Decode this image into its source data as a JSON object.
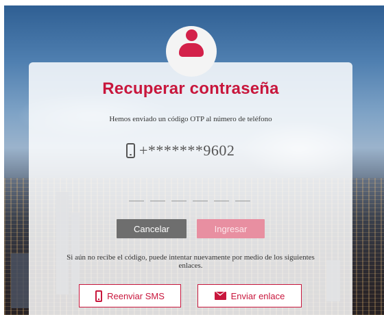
{
  "colors": {
    "brand": "#c8163c",
    "cancel_button": "#6e6e6e",
    "submit_button": "#e88fa1"
  },
  "icons": {
    "avatar": "user-icon",
    "phone": "mobile-phone-icon",
    "sms": "mobile-phone-icon",
    "email": "envelope-icon"
  },
  "form": {
    "title": "Recuperar contraseña",
    "message": "Hemos enviado un código OTP al número de teléfono",
    "phone_number": "+*******9602",
    "otp_length": 6,
    "cancel_label": "Cancelar",
    "submit_label": "Ingresar",
    "help_text": "Si aún no recibe el código, puede intentar nuevamente por medio de los siguientes enlaces.",
    "resend_sms_label": "Reenviar SMS",
    "send_link_label": "Enviar enlace"
  }
}
